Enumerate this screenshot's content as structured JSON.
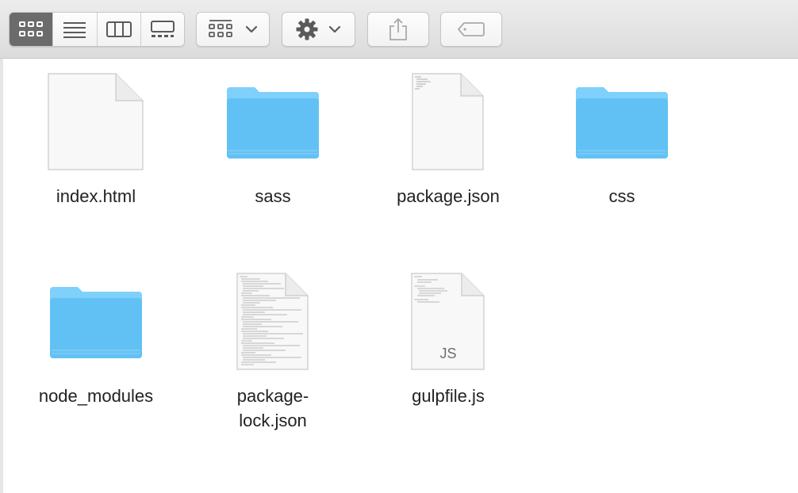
{
  "toolbar": {
    "view_buttons": [
      {
        "icon": "icon-view-grid-icon",
        "active": true
      },
      {
        "icon": "list-view-icon",
        "active": false
      },
      {
        "icon": "column-view-icon",
        "active": false
      },
      {
        "icon": "gallery-view-icon",
        "active": false
      }
    ],
    "group_icon": "group-by-icon",
    "action_icon": "gear-icon",
    "share_icon": "share-icon",
    "tag_icon": "tag-icon",
    "colors": {
      "active_segment": "#6b6b6b",
      "icon": "#5a5a5a"
    }
  },
  "files": [
    {
      "name": "index.html",
      "kind": "document"
    },
    {
      "name": "sass",
      "kind": "folder"
    },
    {
      "name": "package.json",
      "kind": "document-text"
    },
    {
      "name": "css",
      "kind": "folder"
    },
    {
      "name": "node_modules",
      "kind": "folder"
    },
    {
      "name_line1": "package-",
      "name_line2": "lock.json",
      "kind": "document-text-dense"
    },
    {
      "name": "gulpfile.js",
      "kind": "js-file",
      "badge": "JS"
    }
  ],
  "colors": {
    "folder_top": "#7fd0fb",
    "folder_body": "#62c1f4"
  }
}
